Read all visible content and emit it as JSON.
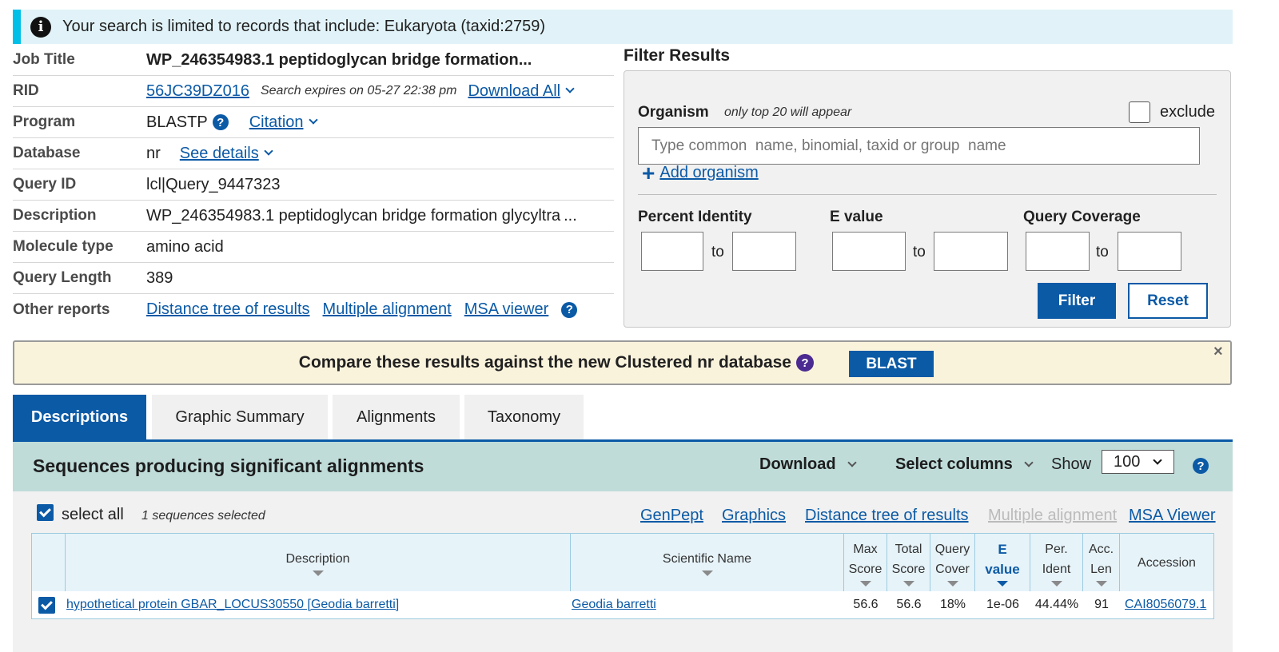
{
  "info_banner": {
    "text": "Your search is limited to records that include: Eukaryota (taxid:2759)"
  },
  "job": {
    "job_title_label": "Job Title",
    "job_title": "WP_246354983.1 peptidoglycan bridge formation...",
    "rid_label": "RID",
    "rid": "56JC39DZ016",
    "expires": "Search expires on 05-27 22:38 pm",
    "download_all": "Download All",
    "program_label": "Program",
    "program": "BLASTP",
    "citation": "Citation",
    "database_label": "Database",
    "database": "nr",
    "see_details": "See details",
    "query_id_label": "Query ID",
    "query_id": "lcl|Query_9447323",
    "description_label": "Description",
    "description": "WP_246354983.1 peptidoglycan bridge formation glycyltra",
    "description_more": "...",
    "molecule_label": "Molecule type",
    "molecule": "amino acid",
    "length_label": "Query Length",
    "length": "389",
    "other_label": "Other reports",
    "other_links": [
      "Distance tree of results",
      "Multiple alignment",
      "MSA viewer"
    ]
  },
  "filter": {
    "title": "Filter Results",
    "organism_label": "Organism",
    "organism_note": "only top 20 will appear",
    "exclude_label": "exclude",
    "organism_placeholder": "Type common  name, binomial, taxid or group  name",
    "add_organism": "Add organism",
    "percent_identity": "Percent Identity",
    "e_value": "E value",
    "query_coverage": "Query Coverage",
    "to": "to",
    "filter_btn": "Filter",
    "reset_btn": "Reset"
  },
  "compare": {
    "text": "Compare these results against the new Clustered nr database",
    "blast_btn": "BLAST",
    "close": "×"
  },
  "tabs": [
    "Descriptions",
    "Graphic Summary",
    "Alignments",
    "Taxonomy"
  ],
  "results": {
    "title": "Sequences producing significant alignments",
    "download": "Download",
    "select_columns": "Select columns",
    "show_label": "Show",
    "show_value": "100",
    "select_all": "select all",
    "selected_count": "1 sequences selected",
    "links": [
      "GenPept",
      "Graphics",
      "Distance tree of results",
      "Multiple alignment",
      "MSA Viewer"
    ],
    "columns": {
      "description": "Description",
      "scientific_name": "Scientific Name",
      "max_score": [
        "Max",
        "Score"
      ],
      "total_score": [
        "Total",
        "Score"
      ],
      "query_cover": [
        "Query",
        "Cover"
      ],
      "e_value": [
        "E",
        "value"
      ],
      "per_ident": [
        "Per.",
        "Ident"
      ],
      "acc_len": [
        "Acc.",
        "Len"
      ],
      "accession": "Accession"
    },
    "rows": [
      {
        "description": "hypothetical protein GBAR_LOCUS30550 [Geodia barretti]",
        "scientific_name": "Geodia barretti",
        "max_score": "56.6",
        "total_score": "56.6",
        "query_cover": "18%",
        "e_value": "1e-06",
        "per_ident": "44.44%",
        "acc_len": "91",
        "accession": "CAI8056079.1"
      }
    ]
  }
}
